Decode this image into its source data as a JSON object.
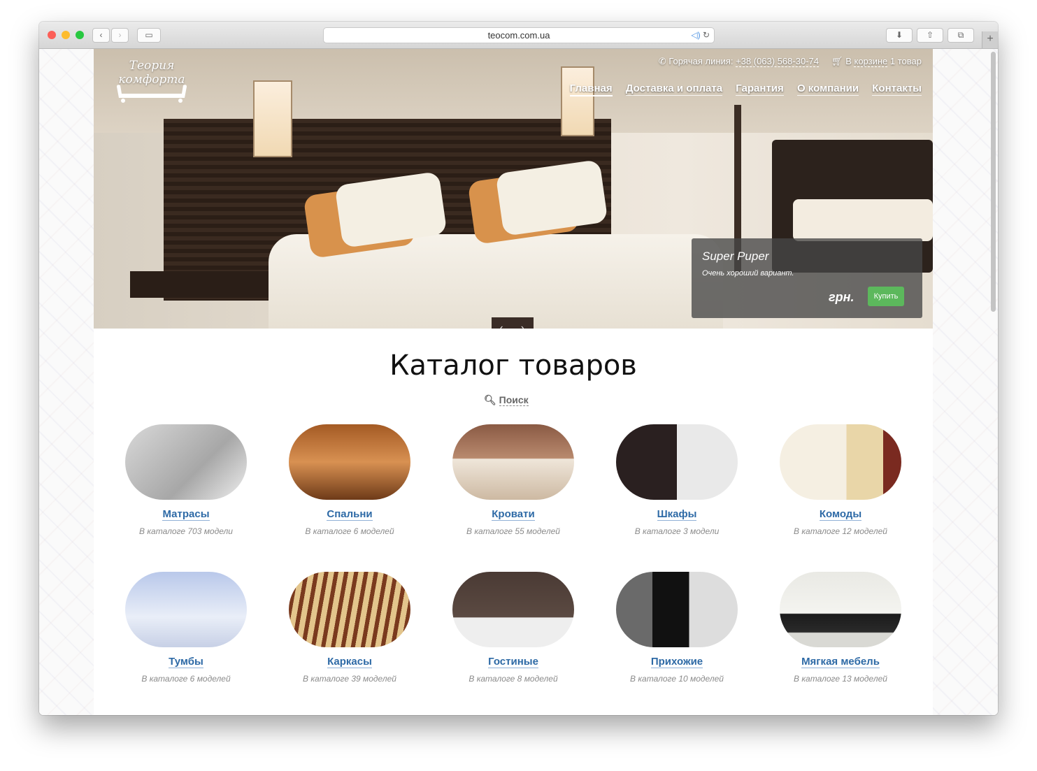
{
  "browser": {
    "url": "teocom.com.ua"
  },
  "header": {
    "logo_text_line1": "Теория",
    "logo_text_line2": "комфорта",
    "hotline_label": "Горячая линия:",
    "hotline_phone": "+38 (063) 568-30-74",
    "cart_prefix": "В",
    "cart_link": "корзине",
    "cart_count": "1 товар",
    "nav": [
      "Главная",
      "Доставка и оплата",
      "Гарантия",
      "О компании",
      "Контакты"
    ]
  },
  "promo": {
    "title": "Super Puper",
    "subtitle": "Очень хороший вариант.",
    "price": "грн.",
    "buy_label": "Купить"
  },
  "catalog": {
    "title": "Каталог товаров",
    "search_label": "Поиск",
    "items": [
      {
        "name": "Матрасы",
        "count": "В каталоге 703 модели"
      },
      {
        "name": "Спальни",
        "count": "В каталоге 6 моделей"
      },
      {
        "name": "Кровати",
        "count": "В каталоге 55 моделей"
      },
      {
        "name": "Шкафы",
        "count": "В каталоге 3 модели"
      },
      {
        "name": "Комоды",
        "count": "В каталоге 12 моделей"
      },
      {
        "name": "Тумбы",
        "count": "В каталоге 6 моделей"
      },
      {
        "name": "Каркасы",
        "count": "В каталоге 39 моделей"
      },
      {
        "name": "Гостиные",
        "count": "В каталоге 8 моделей"
      },
      {
        "name": "Прихожие",
        "count": "В каталоге 10 моделей"
      },
      {
        "name": "Мягкая мебель",
        "count": "В каталоге 13 моделей"
      }
    ]
  },
  "icons": {
    "phone": "phone-icon",
    "cart": "cart-icon",
    "search": "search-icon",
    "prev": "chevron-left-icon",
    "next": "chevron-right-icon"
  },
  "colors": {
    "link": "#2e6aa6",
    "buy_button": "#5cb85c",
    "slider_control": "#3a2c26"
  }
}
